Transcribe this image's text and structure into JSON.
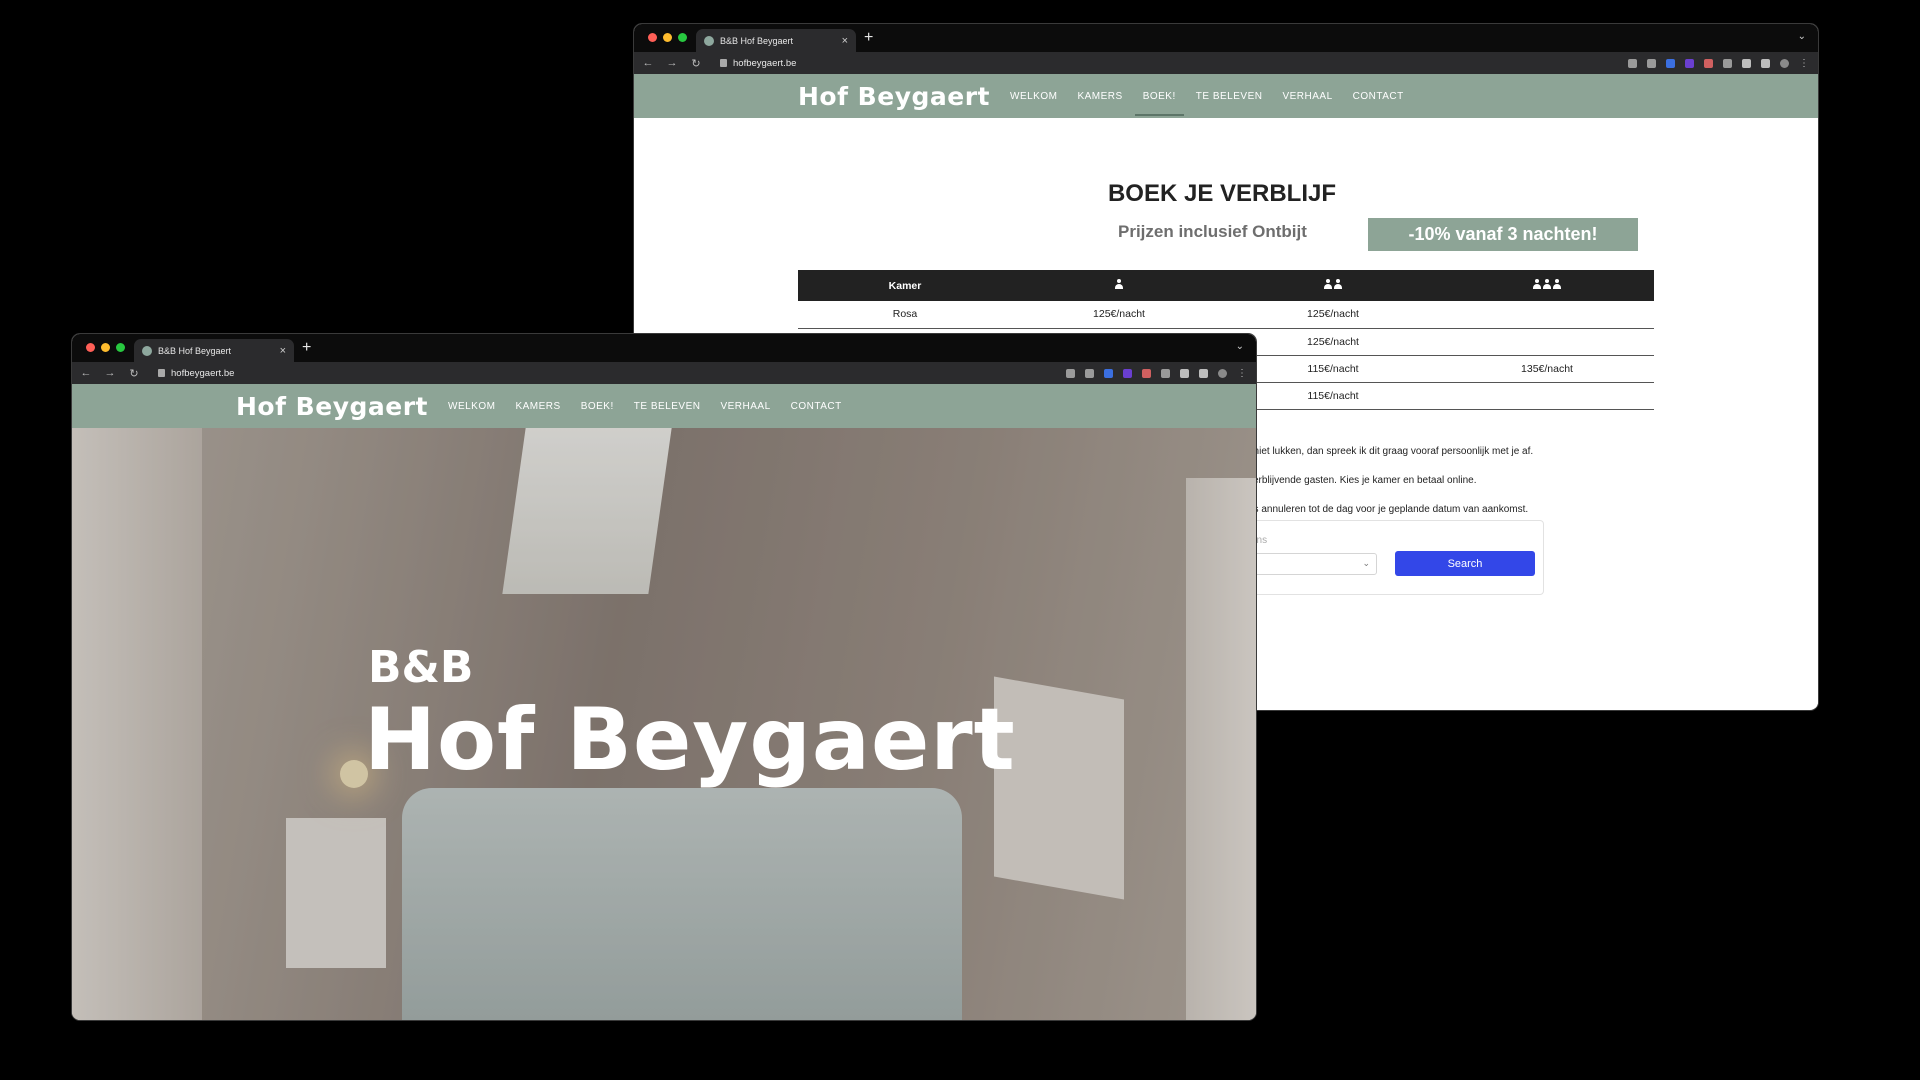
{
  "back_window": {
    "tab_title": "B&B Hof Beygaert",
    "url": "hofbeygaert.be",
    "logo": "Hof Beygaert",
    "menu": [
      "WELKOM",
      "KAMERS",
      "BOEK!",
      "TE BELEVEN",
      "VERHAAL",
      "CONTACT"
    ],
    "active_menu": "BOEK!",
    "title": "BOEK JE VERBLIJF",
    "subtitle": "Prijzen inclusief Ontbijt",
    "promo": "-10% vanaf 3 nachten!",
    "table": {
      "header": [
        "Kamer",
        "1 person icon",
        "2 persons icon",
        "3 persons icon"
      ],
      "rows": [
        [
          "Rosa",
          "125€/nacht",
          "125€/nacht",
          ""
        ],
        [
          "",
          "",
          "125€/nacht",
          ""
        ],
        [
          "",
          "",
          "115€/nacht",
          "135€/nacht"
        ],
        [
          "",
          "",
          "115€/nacht",
          ""
        ]
      ]
    },
    "info_lines": [
      "t niet lukken, dan spreek ik dit graag vooraf persoonlijk met je af.",
      "verblijvende gasten. Kies je kamer en betaal online.",
      "os annuleren tot de dag voor je geplande datum van aankomst."
    ],
    "booking_label": "ons",
    "search_button": "Search"
  },
  "front_window": {
    "tab_title": "B&B Hof Beygaert",
    "url": "hofbeygaert.be",
    "logo": "Hof Beygaert",
    "menu": [
      "WELKOM",
      "KAMERS",
      "BOEK!",
      "TE BELEVEN",
      "VERHAAL",
      "CONTACT"
    ],
    "hero_small": "B&B",
    "hero_big": "Hof Beygaert"
  },
  "colors": {
    "header_green": "#8da496",
    "search_blue": "#3347e8",
    "table_header": "#222222"
  }
}
